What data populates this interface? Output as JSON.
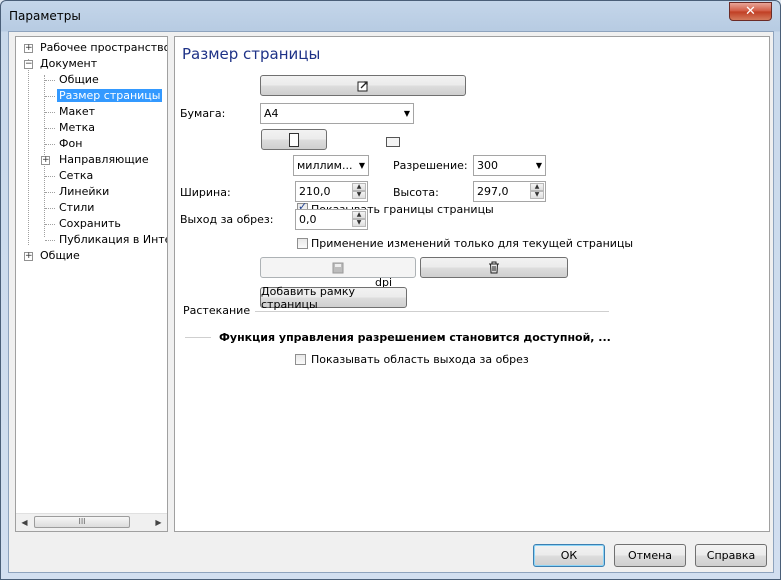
{
  "window": {
    "title": "Параметры",
    "close": "✕"
  },
  "tree": {
    "items": [
      {
        "label": "Рабочее пространство",
        "expander": "+"
      },
      {
        "label": "Документ",
        "expander": "−"
      },
      {
        "label": "Общие"
      },
      {
        "label": "Размер страницы"
      },
      {
        "label": "Макет"
      },
      {
        "label": "Метка"
      },
      {
        "label": "Фон"
      },
      {
        "label": "Направляющие",
        "expander": "+"
      },
      {
        "label": "Сетка"
      },
      {
        "label": "Линейки"
      },
      {
        "label": "Стили"
      },
      {
        "label": "Сохранить"
      },
      {
        "label": "Публикация в Интерн"
      },
      {
        "label": "Общие",
        "expander": "+"
      }
    ],
    "scroll_left": "◀",
    "scroll_right": "▶",
    "thumb_grip": "III"
  },
  "panel": {
    "title": "Размер страницы",
    "paper_label": "Бумага:",
    "paper_value": "A4",
    "units_value": "миллим...",
    "resolution_label": "Разрешение:",
    "resolution_value": "300",
    "width_label": "Ширина:",
    "width_value": "210,0",
    "height_label": "Высота:",
    "height_value": "297,0",
    "show_bounds_label": "Показывать границы страницы",
    "bleed_label": "Выход за обрез:",
    "bleed_value": "0,0",
    "apply_current_label": "Применение изменений только для текущей страницы",
    "dpi_label": "dpi",
    "add_frame_label": "Добавить рамку страницы",
    "rasterize_heading": "Растекание",
    "resolution_note": "Функция управления разрешением становится доступной, ...",
    "show_bleed_label": "Показывать область выхода за обрез"
  },
  "footer": {
    "ok": "ОК",
    "cancel": "Отмена",
    "help": "Справка"
  },
  "icons": {
    "spin_up": "▲",
    "spin_down": "▼",
    "dropdown": "▼",
    "trash": "🗑"
  }
}
